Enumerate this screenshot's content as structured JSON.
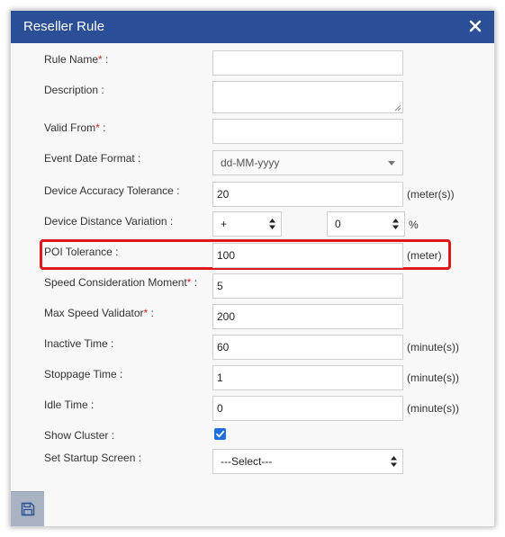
{
  "dialog": {
    "title": "Reseller Rule",
    "close_icon": "close-icon",
    "save_icon": "floppy-disk-icon"
  },
  "fields": {
    "rule_name": {
      "label": "Rule Name",
      "required_mark": "*",
      "suffix": " :",
      "value": ""
    },
    "description": {
      "label": "Description :",
      "value": ""
    },
    "valid_from": {
      "label": "Valid From",
      "required_mark": "*",
      "suffix": " :",
      "value": ""
    },
    "event_date_format": {
      "label": "Event Date Format :",
      "value": "dd-MM-yyyy"
    },
    "device_accuracy_tolerance": {
      "label": "Device Accuracy Tolerance :",
      "value": "20",
      "unit": "(meter(s))"
    },
    "device_distance_variation": {
      "label": "Device Distance Variation :",
      "sign_value": "+",
      "amount_value": "0",
      "unit": "%"
    },
    "poi_tolerance": {
      "label": "POI Tolerance :",
      "value": "100",
      "unit": "(meter)"
    },
    "speed_consideration_moment": {
      "label": "Speed Consideration Moment",
      "required_mark": "*",
      "suffix": " :",
      "value": "5"
    },
    "max_speed_validator": {
      "label": "Max Speed Validator",
      "required_mark": "*",
      "suffix": " :",
      "value": "200"
    },
    "inactive_time": {
      "label": "Inactive Time :",
      "value": "60",
      "unit": "(minute(s))"
    },
    "stoppage_time": {
      "label": "Stoppage Time :",
      "value": "1",
      "unit": "(minute(s))"
    },
    "idle_time": {
      "label": "Idle Time :",
      "value": "0",
      "unit": "(minute(s))"
    },
    "show_cluster": {
      "label": "Show Cluster :",
      "checked": true
    },
    "set_startup_screen": {
      "label": "Set Startup Screen :",
      "value": "---Select---"
    }
  },
  "colors": {
    "titlebar": "#2a4f96",
    "highlight": "#e0171b",
    "required": "#d9242a",
    "checkbox": "#1f6fe0"
  }
}
